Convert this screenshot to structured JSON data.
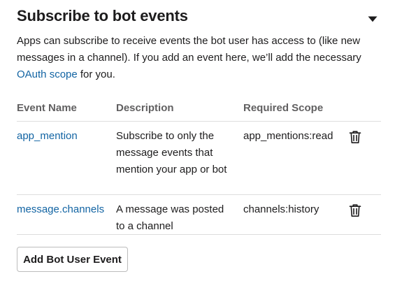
{
  "section": {
    "title": "Subscribe to bot events",
    "collapse_icon": "caret-down-icon"
  },
  "description": {
    "part1": "Apps can subscribe to receive events the bot user has access to (like new messages in a channel). If you add an event here, we’ll add the necessary ",
    "link": "OAuth scope",
    "part2": " for you."
  },
  "table": {
    "headers": {
      "event_name": "Event Name",
      "description": "Description",
      "required_scope": "Required Scope"
    },
    "rows": [
      {
        "event_name": "app_mention",
        "description": "Subscribe to only the message events that mention your app or bot",
        "required_scope": "app_mentions:read",
        "delete_icon": "trash-icon"
      },
      {
        "event_name": "message.channels",
        "description": "A message was posted to a channel",
        "required_scope": "channels:history",
        "delete_icon": "trash-icon"
      }
    ]
  },
  "add_button": {
    "label": "Add Bot User Event"
  },
  "colors": {
    "link": "#1264a3",
    "text": "#1d1c1d",
    "muted_header": "#616061",
    "divider": "#dddddd"
  }
}
